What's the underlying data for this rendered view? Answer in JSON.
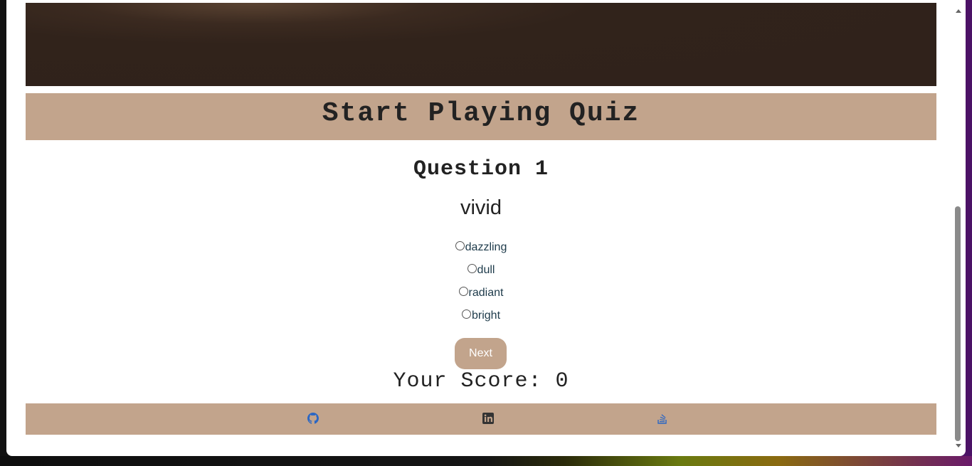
{
  "hero": {
    "title": "Start Playing Quiz"
  },
  "quiz": {
    "question_label": "Question 1",
    "word": "vivid",
    "options": [
      "dazzling",
      "dull",
      "radiant",
      "bright"
    ],
    "next_label": "Next",
    "score_label": "Your Score: 0"
  },
  "footer": {
    "icons": [
      "github-icon",
      "linkedin-icon",
      "stack-overflow-icon"
    ]
  },
  "colors": {
    "accent": "#c2a48c",
    "hero_dark": "#31231b",
    "option_text": "#1d3a4a"
  }
}
